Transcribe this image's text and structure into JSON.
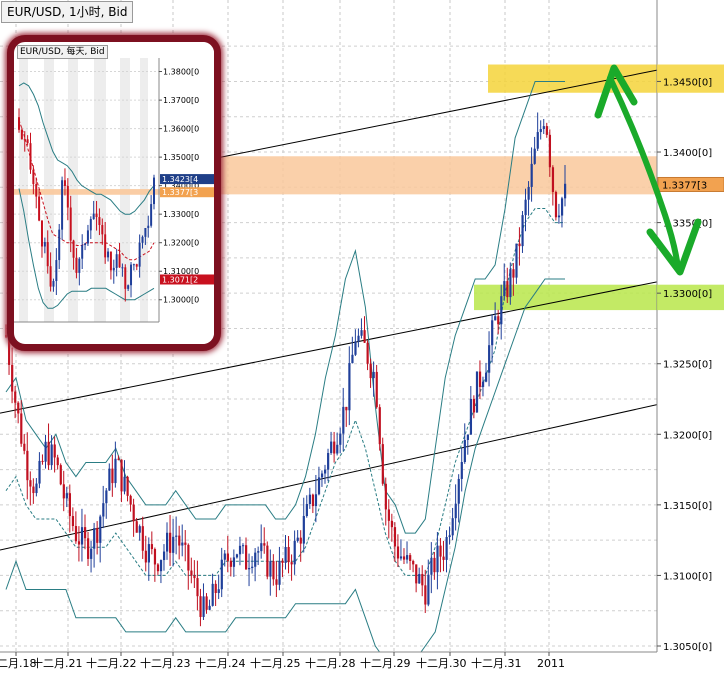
{
  "main_chart": {
    "title": "EUR/USD, 1小时, Bid",
    "chart_data": {
      "type": "candlestick",
      "symbol": "EUR/USD",
      "timeframe": "1小时",
      "price_type": "Bid",
      "ylim": [
        1.305,
        1.349
      ],
      "y_ticks": [
        "1.3450[0]",
        "1.3400[0]",
        "1.3350[0]",
        "1.3300[0]",
        "1.3250[0]",
        "1.3200[0]",
        "1.3150[0]",
        "1.3100[0]",
        "1.3050[0]"
      ],
      "x_ticks": [
        "二月.18",
        "十二月.21",
        "十二月.22",
        "十二月.23",
        "十二月.24",
        "十二月.25",
        "十二月.28",
        "十二月.29",
        "十二月.30",
        "十二月.31",
        "2011"
      ],
      "current_price_label": "1.3377[3",
      "zones": [
        {
          "name": "resistance-upper",
          "price": [
            1.3442,
            1.3462
          ],
          "color": "#f5d33a"
        },
        {
          "name": "resistance",
          "price": [
            1.337,
            1.3397
          ],
          "color": "#f9c89b"
        },
        {
          "name": "support",
          "price": [
            1.3288,
            1.3306
          ],
          "color": "#b8e64a"
        }
      ],
      "close_path": [
        1.327,
        1.322,
        1.318,
        1.316,
        1.319,
        1.318,
        1.315,
        1.313,
        1.312,
        1.313,
        1.316,
        1.318,
        1.316,
        1.314,
        1.312,
        1.311,
        1.312,
        1.313,
        1.311,
        1.309,
        1.307,
        1.309,
        1.311,
        1.312,
        1.311,
        1.312,
        1.311,
        1.31,
        1.311,
        1.312,
        1.314,
        1.316,
        1.318,
        1.32,
        1.322,
        1.327,
        1.326,
        1.324,
        1.315,
        1.312,
        1.311,
        1.31,
        1.309,
        1.311,
        1.312,
        1.316,
        1.32,
        1.323,
        1.325,
        1.328,
        1.33,
        1.332,
        1.336,
        1.34,
        1.343,
        1.336,
        1.337
      ],
      "series": [
        {
          "name": "bollinger-upper",
          "values": [
            1.323,
            1.324,
            1.321,
            1.32,
            1.319,
            1.32,
            1.318,
            1.317,
            1.318,
            1.318,
            1.318,
            1.319,
            1.317,
            1.316,
            1.315,
            1.315,
            1.315,
            1.316,
            1.315,
            1.314,
            1.314,
            1.314,
            1.315,
            1.315,
            1.315,
            1.315,
            1.315,
            1.314,
            1.314,
            1.315,
            1.317,
            1.32,
            1.324,
            1.327,
            1.331,
            1.333,
            1.329,
            1.322,
            1.316,
            1.315,
            1.313,
            1.313,
            1.314,
            1.319,
            1.324,
            1.327,
            1.329,
            1.331,
            1.331,
            1.332,
            1.336,
            1.341,
            1.343,
            1.345,
            1.345,
            1.345,
            1.345
          ]
        },
        {
          "name": "bollinger-lower",
          "values": [
            1.309,
            1.311,
            1.309,
            1.309,
            1.309,
            1.309,
            1.309,
            1.307,
            1.307,
            1.307,
            1.307,
            1.307,
            1.306,
            1.306,
            1.306,
            1.306,
            1.306,
            1.307,
            1.306,
            1.306,
            1.306,
            1.306,
            1.306,
            1.307,
            1.307,
            1.307,
            1.307,
            1.307,
            1.307,
            1.308,
            1.308,
            1.308,
            1.308,
            1.308,
            1.308,
            1.309,
            1.307,
            1.305,
            1.304,
            1.304,
            1.304,
            1.304,
            1.305,
            1.306,
            1.309,
            1.312,
            1.316,
            1.319,
            1.321,
            1.323,
            1.325,
            1.327,
            1.329,
            1.33,
            1.331,
            1.331,
            1.331
          ]
        },
        {
          "name": "moving-average",
          "values": [
            1.316,
            1.317,
            1.315,
            1.314,
            1.314,
            1.314,
            1.313,
            1.312,
            1.312,
            1.312,
            1.312,
            1.313,
            1.312,
            1.311,
            1.31,
            1.31,
            1.31,
            1.311,
            1.31,
            1.31,
            1.31,
            1.31,
            1.311,
            1.311,
            1.311,
            1.311,
            1.311,
            1.311,
            1.311,
            1.311,
            1.312,
            1.314,
            1.316,
            1.318,
            1.319,
            1.321,
            1.319,
            1.316,
            1.313,
            1.311,
            1.31,
            1.31,
            1.31,
            1.312,
            1.315,
            1.318,
            1.32,
            1.322,
            1.324,
            1.326,
            1.33,
            1.333,
            1.335,
            1.336,
            1.336,
            1.335,
            1.335
          ]
        }
      ],
      "trendlines": [
        {
          "name": "channel-upper",
          "from": [
            0.3,
            1.3393
          ],
          "to": [
            1.0,
            1.3458
          ]
        },
        {
          "name": "channel-middle",
          "from": [
            0.0,
            1.3215
          ],
          "to": [
            1.0,
            1.3308
          ]
        },
        {
          "name": "channel-lower",
          "from": [
            0.0,
            1.3118
          ],
          "to": [
            1.0,
            1.3221
          ]
        }
      ],
      "arrow_color": "#1aaa2a"
    }
  },
  "inset_chart": {
    "title": "EUR/USD, 每天, Bid",
    "chart_data": {
      "type": "candlestick",
      "symbol": "EUR/USD",
      "timeframe": "每天",
      "price_type": "Bid",
      "ylim": [
        1.295,
        1.383
      ],
      "y_ticks": [
        "1.3800[0",
        "1.3700[0",
        "1.3600[0",
        "1.3500[0",
        "1.3400[0",
        "1.3300[0",
        "1.3200[0",
        "1.3100[0",
        "1.3000[0"
      ],
      "price_labels": [
        {
          "text": "1.3423[4",
          "color": "#1f3f88"
        },
        {
          "text": "1.3377[3",
          "color": "#f2a250"
        },
        {
          "text": "1.3071[2",
          "color": "#c8101e"
        }
      ],
      "zone": {
        "price": [
          1.3368,
          1.3388
        ],
        "color": "#f9c89b"
      },
      "close_path": [
        1.36,
        1.355,
        1.35,
        1.34,
        1.33,
        1.32,
        1.31,
        1.3,
        1.32,
        1.34,
        1.335,
        1.32,
        1.31,
        1.315,
        1.325,
        1.333,
        1.33,
        1.32,
        1.318,
        1.312,
        1.315,
        1.31,
        1.305,
        1.31,
        1.312,
        1.318,
        1.32,
        1.33,
        1.342
      ],
      "series": [
        {
          "name": "bollinger-upper",
          "values": [
            1.375,
            1.376,
            1.375,
            1.372,
            1.368,
            1.362,
            1.357,
            1.352,
            1.349,
            1.348,
            1.347,
            1.345,
            1.342,
            1.34,
            1.339,
            1.338,
            1.337,
            1.337,
            1.336,
            1.335,
            1.333,
            1.331,
            1.33,
            1.33,
            1.331,
            1.333,
            1.335,
            1.338,
            1.34
          ]
        },
        {
          "name": "bollinger-lower",
          "values": [
            1.339,
            1.331,
            1.321,
            1.312,
            1.304,
            1.299,
            1.297,
            1.297,
            1.298,
            1.3,
            1.302,
            1.303,
            1.303,
            1.303,
            1.303,
            1.304,
            1.304,
            1.304,
            1.304,
            1.303,
            1.302,
            1.301,
            1.3,
            1.3,
            1.3,
            1.301,
            1.302,
            1.303,
            1.304
          ]
        },
        {
          "name": "moving-average",
          "values": [
            1.363,
            1.358,
            1.352,
            1.346,
            1.34,
            1.334,
            1.328,
            1.323,
            1.322,
            1.321,
            1.32,
            1.32,
            1.319,
            1.319,
            1.32,
            1.32,
            1.32,
            1.32,
            1.32,
            1.319,
            1.318,
            1.317,
            1.315,
            1.314,
            1.314,
            1.315,
            1.316,
            1.317,
            1.32
          ]
        }
      ]
    }
  }
}
